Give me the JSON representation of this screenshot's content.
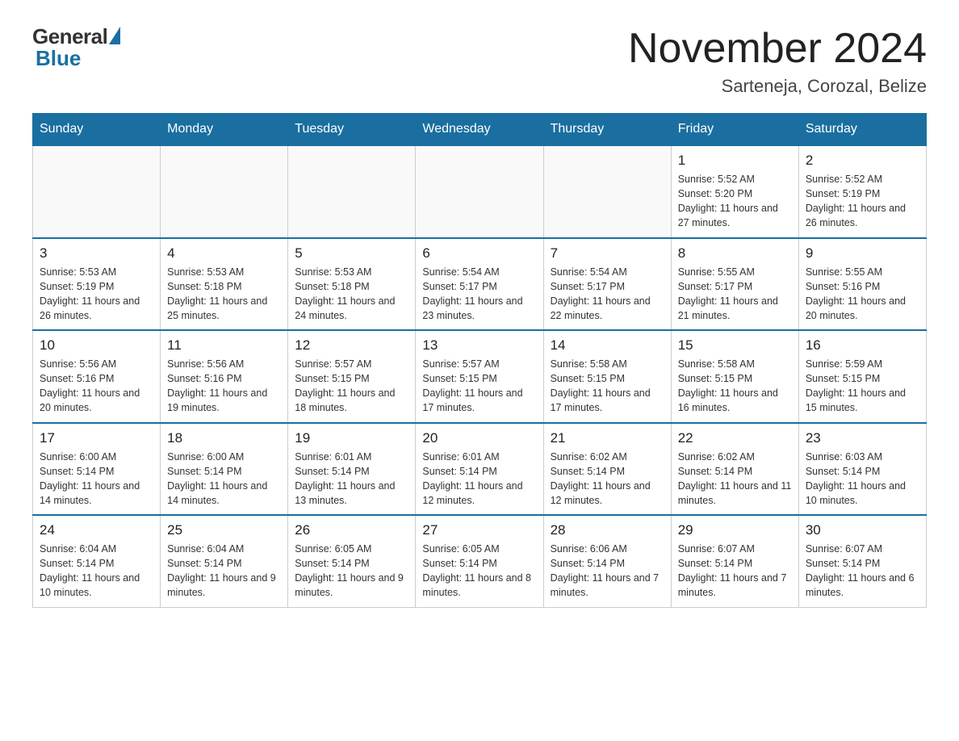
{
  "header": {
    "logo_general": "General",
    "logo_blue": "Blue",
    "month_title": "November 2024",
    "location": "Sarteneja, Corozal, Belize"
  },
  "days_of_week": [
    "Sunday",
    "Monday",
    "Tuesday",
    "Wednesday",
    "Thursday",
    "Friday",
    "Saturday"
  ],
  "weeks": [
    [
      {
        "day": "",
        "sunrise": "",
        "sunset": "",
        "daylight": ""
      },
      {
        "day": "",
        "sunrise": "",
        "sunset": "",
        "daylight": ""
      },
      {
        "day": "",
        "sunrise": "",
        "sunset": "",
        "daylight": ""
      },
      {
        "day": "",
        "sunrise": "",
        "sunset": "",
        "daylight": ""
      },
      {
        "day": "",
        "sunrise": "",
        "sunset": "",
        "daylight": ""
      },
      {
        "day": "1",
        "sunrise": "Sunrise: 5:52 AM",
        "sunset": "Sunset: 5:20 PM",
        "daylight": "Daylight: 11 hours and 27 minutes."
      },
      {
        "day": "2",
        "sunrise": "Sunrise: 5:52 AM",
        "sunset": "Sunset: 5:19 PM",
        "daylight": "Daylight: 11 hours and 26 minutes."
      }
    ],
    [
      {
        "day": "3",
        "sunrise": "Sunrise: 5:53 AM",
        "sunset": "Sunset: 5:19 PM",
        "daylight": "Daylight: 11 hours and 26 minutes."
      },
      {
        "day": "4",
        "sunrise": "Sunrise: 5:53 AM",
        "sunset": "Sunset: 5:18 PM",
        "daylight": "Daylight: 11 hours and 25 minutes."
      },
      {
        "day": "5",
        "sunrise": "Sunrise: 5:53 AM",
        "sunset": "Sunset: 5:18 PM",
        "daylight": "Daylight: 11 hours and 24 minutes."
      },
      {
        "day": "6",
        "sunrise": "Sunrise: 5:54 AM",
        "sunset": "Sunset: 5:17 PM",
        "daylight": "Daylight: 11 hours and 23 minutes."
      },
      {
        "day": "7",
        "sunrise": "Sunrise: 5:54 AM",
        "sunset": "Sunset: 5:17 PM",
        "daylight": "Daylight: 11 hours and 22 minutes."
      },
      {
        "day": "8",
        "sunrise": "Sunrise: 5:55 AM",
        "sunset": "Sunset: 5:17 PM",
        "daylight": "Daylight: 11 hours and 21 minutes."
      },
      {
        "day": "9",
        "sunrise": "Sunrise: 5:55 AM",
        "sunset": "Sunset: 5:16 PM",
        "daylight": "Daylight: 11 hours and 20 minutes."
      }
    ],
    [
      {
        "day": "10",
        "sunrise": "Sunrise: 5:56 AM",
        "sunset": "Sunset: 5:16 PM",
        "daylight": "Daylight: 11 hours and 20 minutes."
      },
      {
        "day": "11",
        "sunrise": "Sunrise: 5:56 AM",
        "sunset": "Sunset: 5:16 PM",
        "daylight": "Daylight: 11 hours and 19 minutes."
      },
      {
        "day": "12",
        "sunrise": "Sunrise: 5:57 AM",
        "sunset": "Sunset: 5:15 PM",
        "daylight": "Daylight: 11 hours and 18 minutes."
      },
      {
        "day": "13",
        "sunrise": "Sunrise: 5:57 AM",
        "sunset": "Sunset: 5:15 PM",
        "daylight": "Daylight: 11 hours and 17 minutes."
      },
      {
        "day": "14",
        "sunrise": "Sunrise: 5:58 AM",
        "sunset": "Sunset: 5:15 PM",
        "daylight": "Daylight: 11 hours and 17 minutes."
      },
      {
        "day": "15",
        "sunrise": "Sunrise: 5:58 AM",
        "sunset": "Sunset: 5:15 PM",
        "daylight": "Daylight: 11 hours and 16 minutes."
      },
      {
        "day": "16",
        "sunrise": "Sunrise: 5:59 AM",
        "sunset": "Sunset: 5:15 PM",
        "daylight": "Daylight: 11 hours and 15 minutes."
      }
    ],
    [
      {
        "day": "17",
        "sunrise": "Sunrise: 6:00 AM",
        "sunset": "Sunset: 5:14 PM",
        "daylight": "Daylight: 11 hours and 14 minutes."
      },
      {
        "day": "18",
        "sunrise": "Sunrise: 6:00 AM",
        "sunset": "Sunset: 5:14 PM",
        "daylight": "Daylight: 11 hours and 14 minutes."
      },
      {
        "day": "19",
        "sunrise": "Sunrise: 6:01 AM",
        "sunset": "Sunset: 5:14 PM",
        "daylight": "Daylight: 11 hours and 13 minutes."
      },
      {
        "day": "20",
        "sunrise": "Sunrise: 6:01 AM",
        "sunset": "Sunset: 5:14 PM",
        "daylight": "Daylight: 11 hours and 12 minutes."
      },
      {
        "day": "21",
        "sunrise": "Sunrise: 6:02 AM",
        "sunset": "Sunset: 5:14 PM",
        "daylight": "Daylight: 11 hours and 12 minutes."
      },
      {
        "day": "22",
        "sunrise": "Sunrise: 6:02 AM",
        "sunset": "Sunset: 5:14 PM",
        "daylight": "Daylight: 11 hours and 11 minutes."
      },
      {
        "day": "23",
        "sunrise": "Sunrise: 6:03 AM",
        "sunset": "Sunset: 5:14 PM",
        "daylight": "Daylight: 11 hours and 10 minutes."
      }
    ],
    [
      {
        "day": "24",
        "sunrise": "Sunrise: 6:04 AM",
        "sunset": "Sunset: 5:14 PM",
        "daylight": "Daylight: 11 hours and 10 minutes."
      },
      {
        "day": "25",
        "sunrise": "Sunrise: 6:04 AM",
        "sunset": "Sunset: 5:14 PM",
        "daylight": "Daylight: 11 hours and 9 minutes."
      },
      {
        "day": "26",
        "sunrise": "Sunrise: 6:05 AM",
        "sunset": "Sunset: 5:14 PM",
        "daylight": "Daylight: 11 hours and 9 minutes."
      },
      {
        "day": "27",
        "sunrise": "Sunrise: 6:05 AM",
        "sunset": "Sunset: 5:14 PM",
        "daylight": "Daylight: 11 hours and 8 minutes."
      },
      {
        "day": "28",
        "sunrise": "Sunrise: 6:06 AM",
        "sunset": "Sunset: 5:14 PM",
        "daylight": "Daylight: 11 hours and 7 minutes."
      },
      {
        "day": "29",
        "sunrise": "Sunrise: 6:07 AM",
        "sunset": "Sunset: 5:14 PM",
        "daylight": "Daylight: 11 hours and 7 minutes."
      },
      {
        "day": "30",
        "sunrise": "Sunrise: 6:07 AM",
        "sunset": "Sunset: 5:14 PM",
        "daylight": "Daylight: 11 hours and 6 minutes."
      }
    ]
  ]
}
